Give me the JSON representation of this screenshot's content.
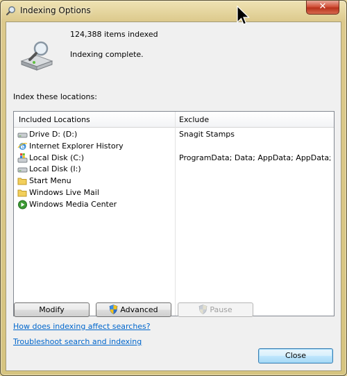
{
  "window": {
    "title": "Indexing Options",
    "close_glyph": "✕"
  },
  "status": {
    "items_indexed": "124,388 items indexed",
    "state": "Indexing complete."
  },
  "locations": {
    "label": "Index these locations:",
    "columns": {
      "included": "Included Locations",
      "exclude": "Exclude"
    },
    "rows": [
      {
        "name": "Drive D: (D:)",
        "exclude": "Snagit Stamps",
        "icon": "drive-icon"
      },
      {
        "name": "Internet Explorer History",
        "exclude": "",
        "icon": "internet-explorer-icon"
      },
      {
        "name": "Local Disk (C:)",
        "exclude": "ProgramData; Data; AppData; AppData; ...",
        "icon": "windows-drive-icon"
      },
      {
        "name": "Local Disk (I:)",
        "exclude": "",
        "icon": "drive-icon"
      },
      {
        "name": "Start Menu",
        "exclude": "",
        "icon": "folder-icon"
      },
      {
        "name": "Windows Live Mail",
        "exclude": "",
        "icon": "folder-icon"
      },
      {
        "name": "Windows Media Center",
        "exclude": "",
        "icon": "media-center-icon"
      }
    ]
  },
  "buttons": {
    "modify": "Modify",
    "advanced": "Advanced",
    "pause": "Pause",
    "close": "Close"
  },
  "links": {
    "how_indexing": "How does indexing affect searches?",
    "troubleshoot": "Troubleshoot search and indexing"
  },
  "colors": {
    "link": "#0066cc",
    "title_bar": "#dcc98c",
    "close_button": "#c7432a"
  }
}
